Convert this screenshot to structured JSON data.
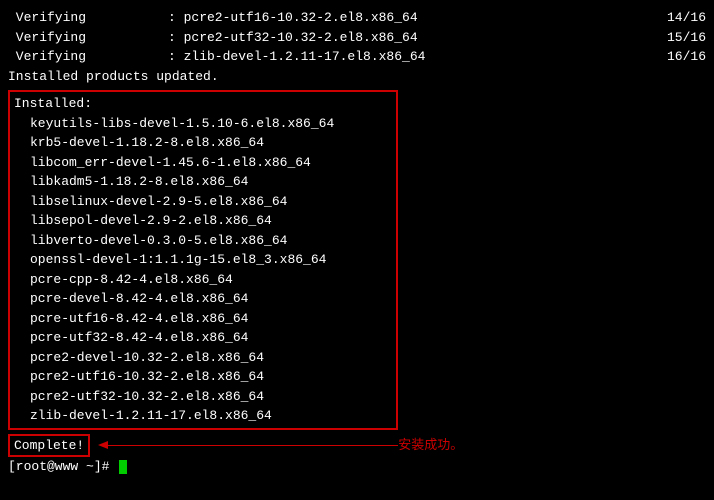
{
  "verify_rows": [
    {
      "label": " Verifying",
      "pkg": ": pcre2-utf16-10.32-2.el8.x86_64",
      "count": "14/16"
    },
    {
      "label": " Verifying",
      "pkg": ": pcre2-utf32-10.32-2.el8.x86_64",
      "count": "15/16"
    },
    {
      "label": " Verifying",
      "pkg": ": zlib-devel-1.2.11-17.el8.x86_64",
      "count": "16/16"
    }
  ],
  "updated_line": "Installed products updated.",
  "installed_header": "Installed:",
  "installed_items": [
    "keyutils-libs-devel-1.5.10-6.el8.x86_64",
    "krb5-devel-1.18.2-8.el8.x86_64",
    "libcom_err-devel-1.45.6-1.el8.x86_64",
    "libkadm5-1.18.2-8.el8.x86_64",
    "libselinux-devel-2.9-5.el8.x86_64",
    "libsepol-devel-2.9-2.el8.x86_64",
    "libverto-devel-0.3.0-5.el8.x86_64",
    "openssl-devel-1:1.1.1g-15.el8_3.x86_64",
    "pcre-cpp-8.42-4.el8.x86_64",
    "pcre-devel-8.42-4.el8.x86_64",
    "pcre-utf16-8.42-4.el8.x86_64",
    "pcre-utf32-8.42-4.el8.x86_64",
    "pcre2-devel-10.32-2.el8.x86_64",
    "pcre2-utf16-10.32-2.el8.x86_64",
    "pcre2-utf32-10.32-2.el8.x86_64",
    "zlib-devel-1.2.11-17.el8.x86_64"
  ],
  "complete_text": "Complete!",
  "annotation_text": "安装成功。",
  "prompt_text": "[root@www ~]# "
}
